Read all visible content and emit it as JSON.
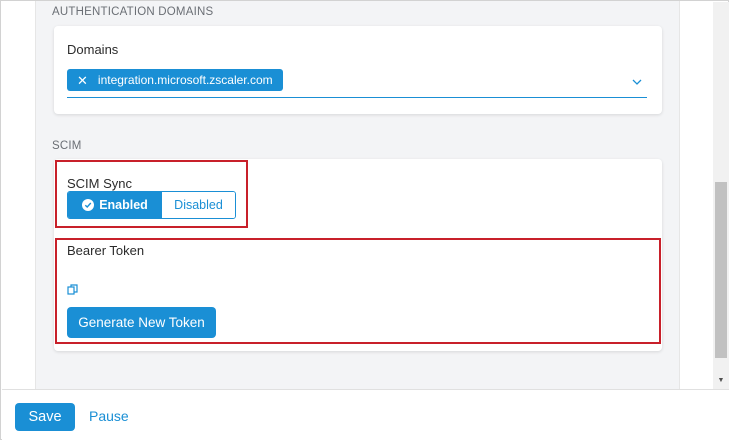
{
  "auth_domains": {
    "heading": "AUTHENTICATION DOMAINS",
    "domains_label": "Domains",
    "selected_domain": "integration.microsoft.zscaler.com",
    "chip_remove_glyph": "✕"
  },
  "scim": {
    "heading": "SCIM",
    "sync_label": "SCIM Sync",
    "enabled_label": "Enabled",
    "disabled_label": "Disabled",
    "sync_state": "Enabled",
    "bearer_token_label": "Bearer Token",
    "copy_icon": "copy-icon",
    "generate_button": "Generate New Token"
  },
  "footer": {
    "save_label": "Save",
    "pause_label": "Pause"
  },
  "colors": {
    "accent": "#1a8fd5",
    "highlight": "#c8202a",
    "content_bg": "#f3f4f6"
  }
}
